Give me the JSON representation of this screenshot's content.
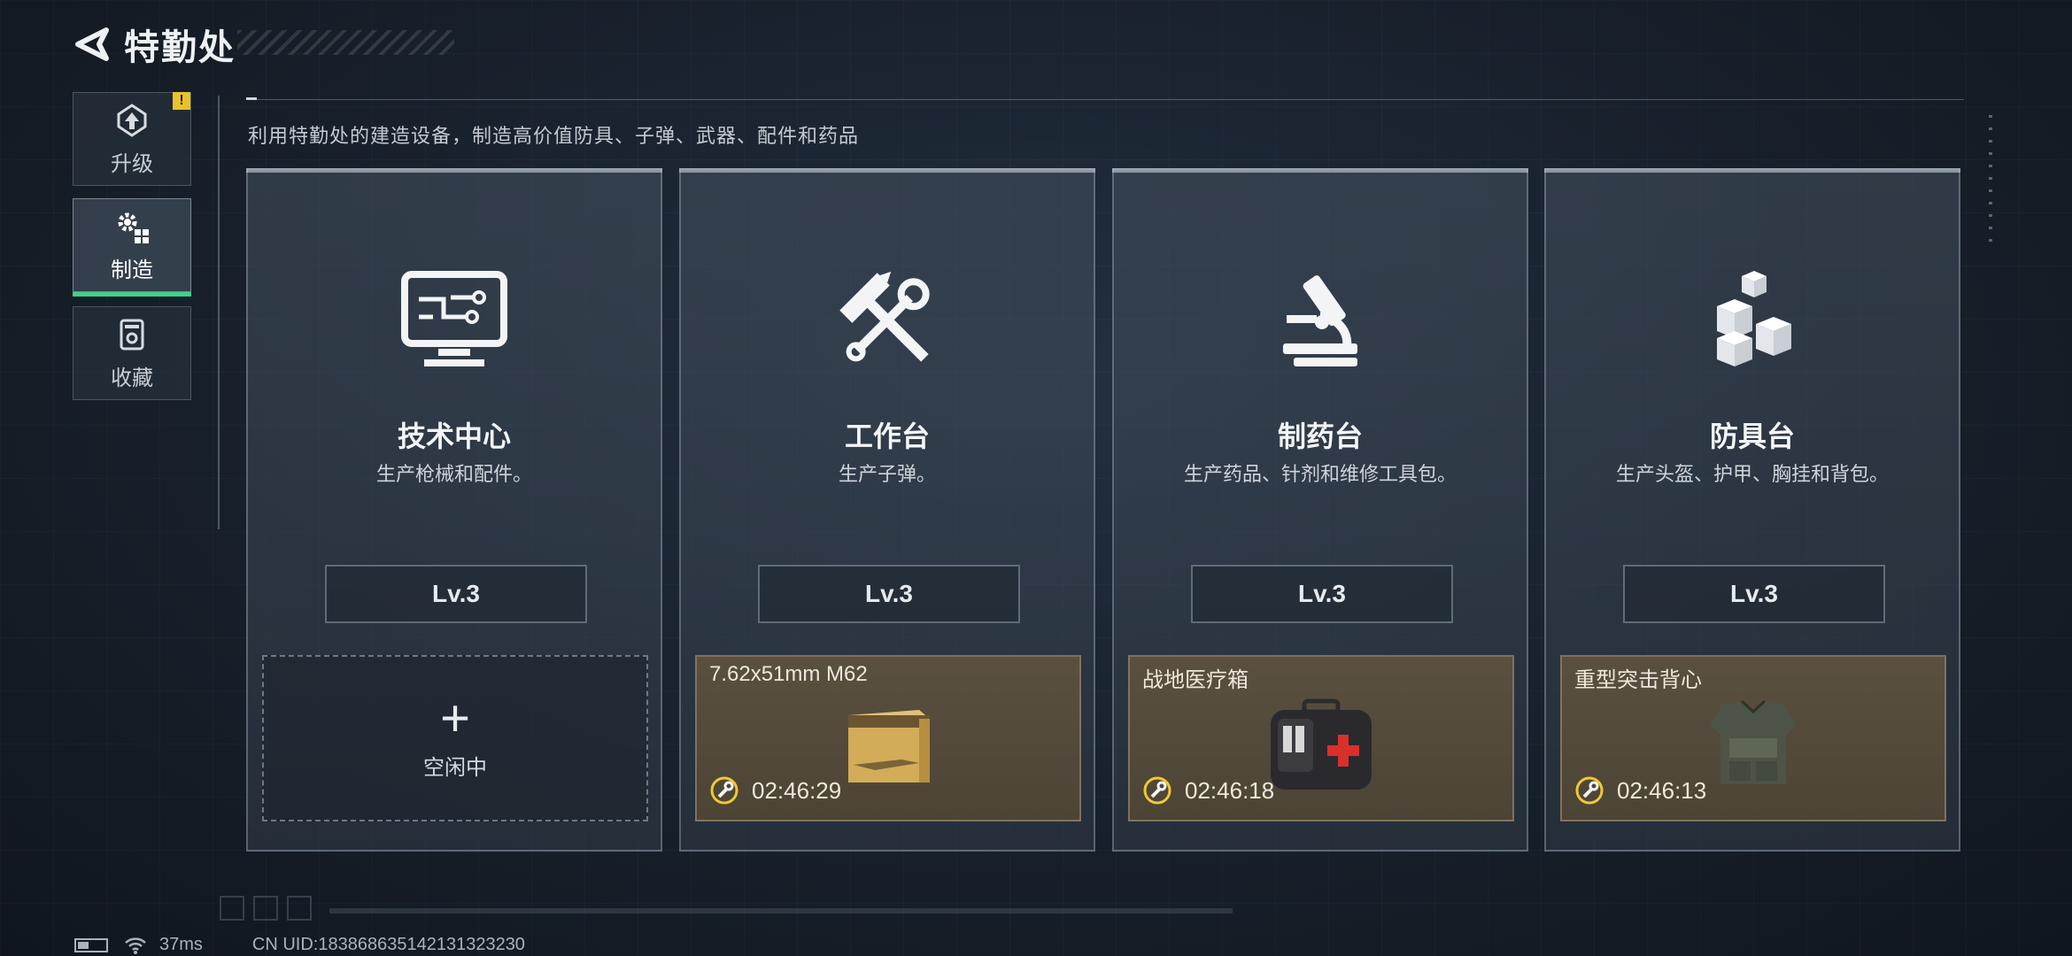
{
  "header": {
    "title": "特勤处",
    "back_icon": "back-arrow-icon"
  },
  "sidebar": {
    "items": [
      {
        "label": "升级",
        "icon": "upgrade-icon",
        "badge": "!"
      },
      {
        "label": "制造",
        "icon": "gears-icon",
        "active": true
      },
      {
        "label": "收藏",
        "icon": "collection-icon"
      }
    ]
  },
  "subtitle": "利用特勤处的建造设备，制造高价值防具、子弹、武器、配件和药品",
  "cards": [
    {
      "title": "技术中心",
      "desc": "生产枪械和配件。",
      "level": "Lv.3",
      "icon": "monitor-circuit-icon",
      "slot": {
        "state": "idle",
        "plus": "+",
        "label": "空闲中"
      }
    },
    {
      "title": "工作台",
      "desc": "生产子弹。",
      "level": "Lv.3",
      "icon": "hammer-wrench-icon",
      "slot": {
        "state": "producing",
        "item": "7.62x51mm M62",
        "timer": "02:46:29",
        "art": "ammo-box-icon"
      }
    },
    {
      "title": "制药台",
      "desc": "生产药品、针剂和维修工具包。",
      "level": "Lv.3",
      "icon": "microscope-icon",
      "slot": {
        "state": "producing",
        "item": "战地医疗箱",
        "timer": "02:46:18",
        "art": "first-aid-kit-icon"
      }
    },
    {
      "title": "防具台",
      "desc": "生产头盔、护甲、胸挂和背包。",
      "level": "Lv.3",
      "icon": "cubes-icon",
      "slot": {
        "state": "producing",
        "item": "重型突击背心",
        "timer": "02:46:13",
        "art": "vest-icon"
      }
    }
  ],
  "footer": {
    "ping": "37ms",
    "uid": "CN UID:18386863514213​1323230"
  },
  "colors": {
    "accent_green": "#3fd08a",
    "badge_yellow": "#e8c22a",
    "timer_yellow": "#f0c830"
  }
}
